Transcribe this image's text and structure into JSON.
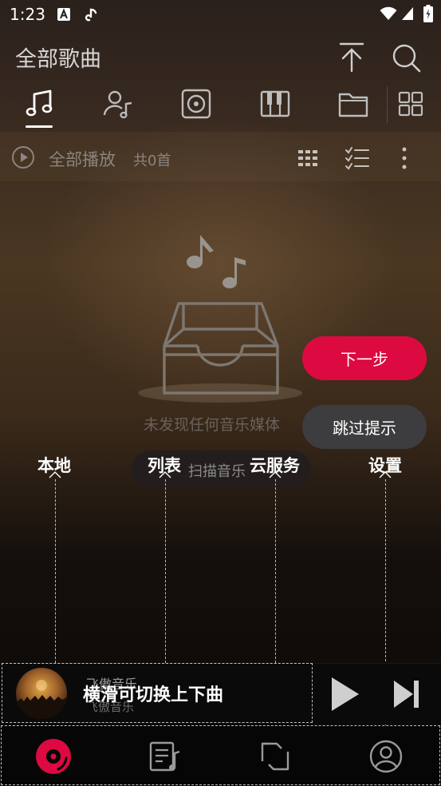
{
  "status_bar": {
    "time": "1:23"
  },
  "header": {
    "title": "全部歌曲"
  },
  "tabs": [
    {
      "name": "songs"
    },
    {
      "name": "artists"
    },
    {
      "name": "albums"
    },
    {
      "name": "piano"
    },
    {
      "name": "folders"
    },
    {
      "name": "more"
    }
  ],
  "list_bar": {
    "play_all": "全部播放",
    "count": "共0首"
  },
  "empty_state": {
    "message": "未发现任何音乐媒体",
    "scan_button": "扫描音乐"
  },
  "guide": {
    "next_button": "下一步",
    "skip_button": "跳过提示",
    "labels": [
      "本地",
      "列表",
      "云服务",
      "设置"
    ],
    "swipe_hint": "横滑可切换上下曲"
  },
  "player": {
    "title": "飞傲音乐",
    "artist": "飞傲音乐"
  },
  "colors": {
    "accent": "#dc0a40",
    "skip_bg": "#3d3d3f",
    "background": "#1a1311"
  }
}
